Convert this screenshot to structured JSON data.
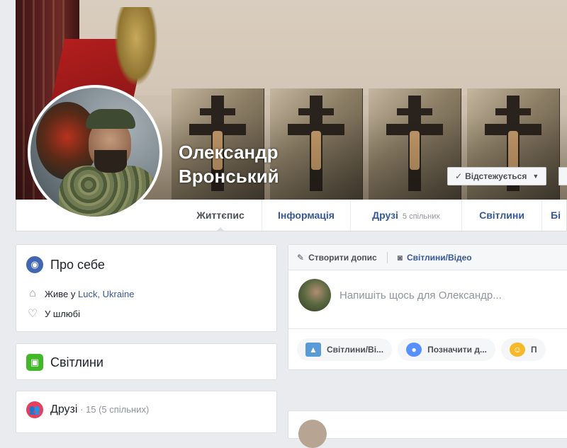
{
  "profile": {
    "name_line1": "Олександр",
    "name_line2": "Вронський",
    "follow_label": "Відстежується"
  },
  "nav": {
    "items": [
      {
        "label": "Життєпис",
        "active": true
      },
      {
        "label": "Інформація"
      },
      {
        "label": "Друзі",
        "sub": "5 спільних"
      },
      {
        "label": "Світлини"
      },
      {
        "label": "Бі"
      }
    ]
  },
  "about": {
    "title": "Про себе",
    "lives_prefix": "Живе у ",
    "lives_place": "Luck, Ukraine",
    "relationship": "У шлюбі"
  },
  "photos": {
    "title": "Світлини"
  },
  "friends": {
    "title": "Друзі",
    "count": " · 15 (5 спільних)"
  },
  "composer": {
    "tab_post": "Створити допис",
    "tab_media": "Світлини/Відео",
    "placeholder": "Напишіть щось для Олександр...",
    "actions": [
      {
        "label": "Світлини/Ві...",
        "icon": "photo-icon",
        "color": "#42b72a"
      },
      {
        "label": "Позначити д...",
        "icon": "tag-friends-icon",
        "color": "#5890ff"
      },
      {
        "label": "П",
        "icon": "feeling-icon",
        "color": "#f7b928"
      }
    ]
  },
  "colors": {
    "brand_link": "#365899",
    "globe_icon": "#4267b2",
    "photos_icon": "#42b72a",
    "friends_icon": "#e4405f"
  }
}
